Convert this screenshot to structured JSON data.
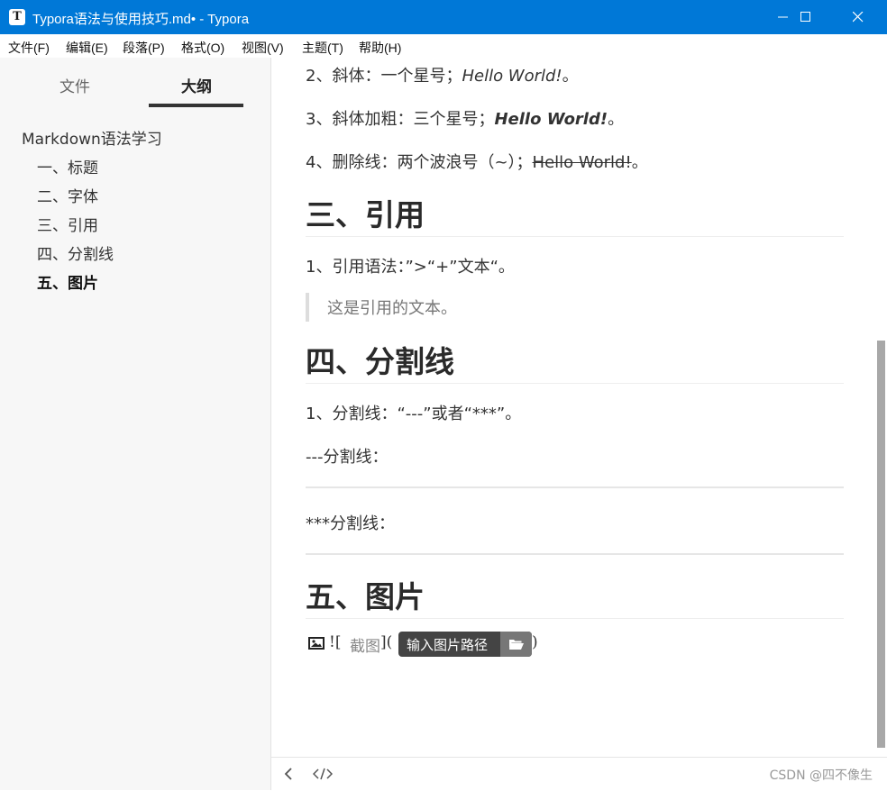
{
  "window": {
    "title": "Typora语法与使用技巧.md• - Typora",
    "app_icon_letter": "T"
  },
  "menu": [
    "文件(F)",
    "编辑(E)",
    "段落(P)",
    "格式(O)",
    "视图(V)",
    "主题(T)",
    "帮助(H)"
  ],
  "sidebar": {
    "tabs": [
      "文件",
      "大纲"
    ],
    "active_tab": "大纲",
    "outline": [
      {
        "label": "Markdown语法学习",
        "level": 1
      },
      {
        "label": "一、标题",
        "level": 2
      },
      {
        "label": "二、字体",
        "level": 2
      },
      {
        "label": "三、引用",
        "level": 2
      },
      {
        "label": "四、分割线",
        "level": 2
      },
      {
        "label": "五、图片",
        "level": 2,
        "active": true
      }
    ]
  },
  "content": {
    "italic_line": {
      "prefix": "2、斜体：一个星号；",
      "example": "Hello World!",
      "suffix": "。"
    },
    "bold_italic_line": {
      "prefix": "3、斜体加粗：三个星号；",
      "example": "Hello World!",
      "suffix": "。"
    },
    "strike_line": {
      "prefix": "4、删除线：两个波浪号（~）；",
      "example": "Hello World!",
      "suffix": "。"
    },
    "h_quote": "三、引用",
    "quote_syntax": "1、引用语法：”>“+”文本“。",
    "blockquote": "这是引用的文本。",
    "h_hr": "四、分割线",
    "hr_syntax": "1、分割线：“---”或者“***”。",
    "hr_dash_label": "---分割线：",
    "hr_star_label": "***分割线：",
    "h_image": "五、图片",
    "image_markdown": {
      "open": "![",
      "alt": "截图",
      "mid": "](",
      "path_tooltip": "输入图片路径",
      "close": ")"
    }
  },
  "footer": {
    "watermark": "CSDN @四不像生"
  },
  "colors": {
    "titlebar": "#0078d7",
    "sidebar_bg": "#f7f7f7",
    "text": "#333333",
    "scrollbar_thumb": "#a8a8a8"
  },
  "icons": [
    "typora-app-icon",
    "minimize-icon",
    "maximize-icon",
    "close-icon",
    "image-icon",
    "folder-open-icon",
    "chevron-left-icon",
    "source-code-icon"
  ]
}
